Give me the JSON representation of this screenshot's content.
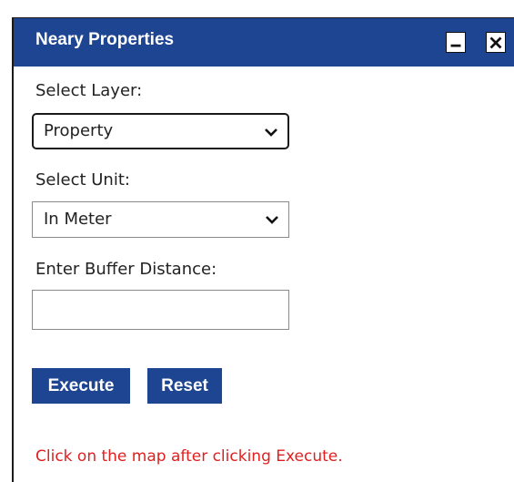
{
  "panel": {
    "title": "Neary Properties",
    "minimize_icon": "minimize-icon",
    "close_icon": "close-icon"
  },
  "form": {
    "layer_label": "Select Layer:",
    "layer_value": "Property",
    "unit_label": "Select Unit:",
    "unit_value": "In Meter",
    "distance_label": "Enter Buffer Distance:",
    "distance_value": "",
    "execute_label": "Execute",
    "reset_label": "Reset",
    "hint": "Click on the map after clicking Execute."
  },
  "colors": {
    "titlebar": "#1d4592",
    "button": "#1d4592",
    "hint_text": "#e0201f"
  }
}
